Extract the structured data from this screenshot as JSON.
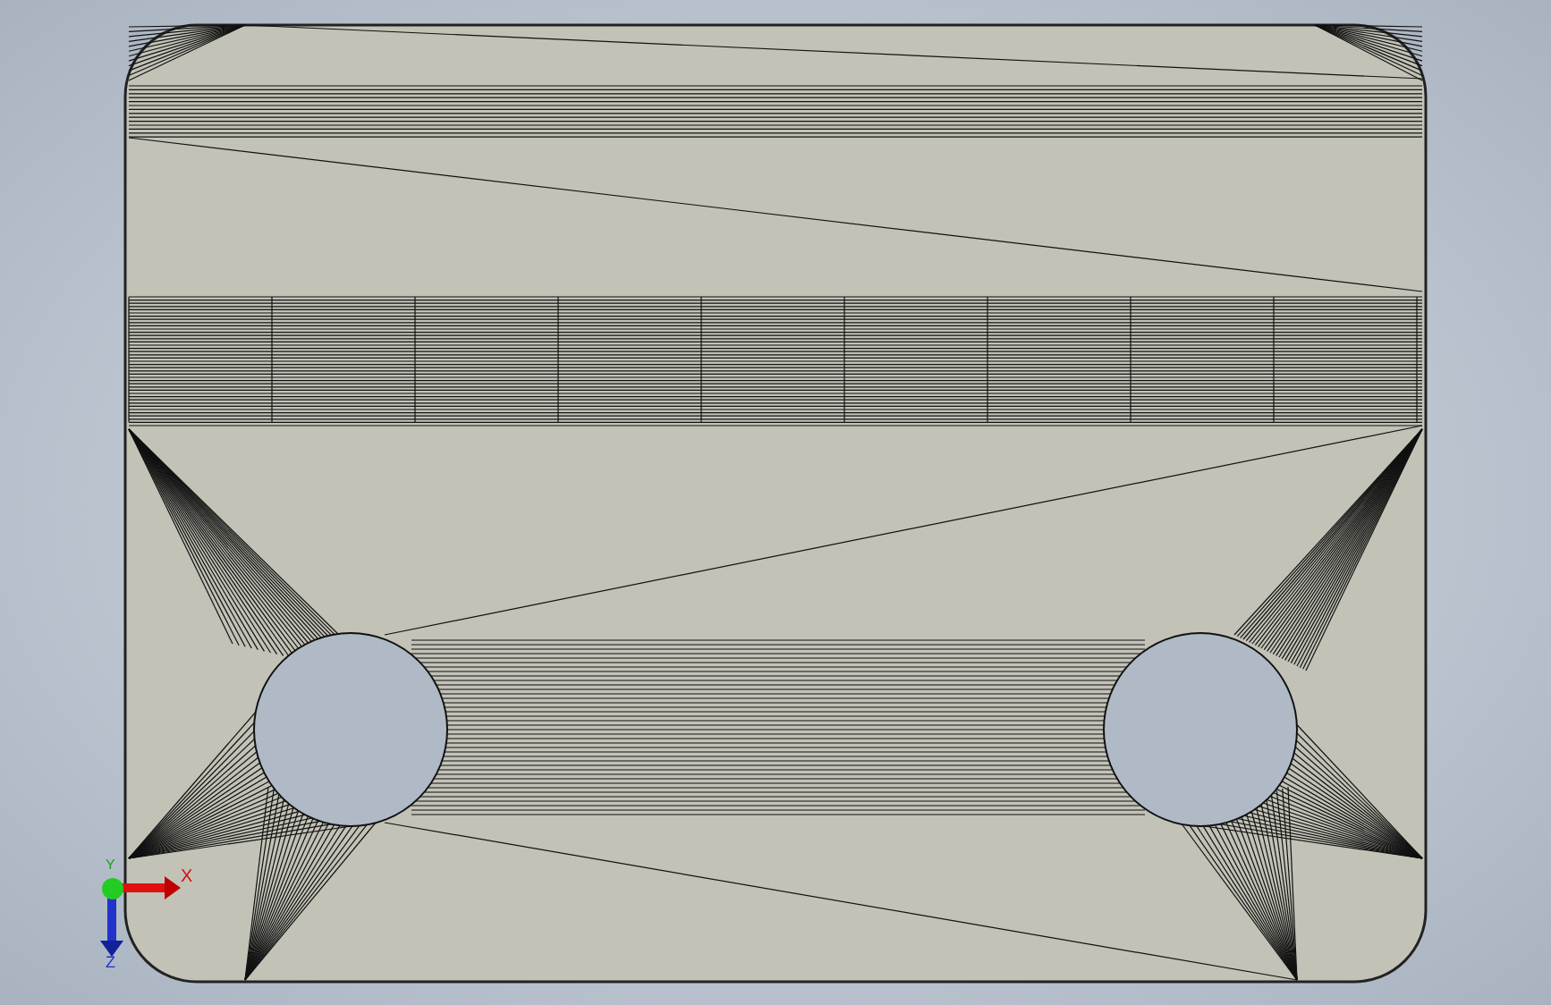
{
  "viewport": {
    "triad": {
      "x_label": "X",
      "y_label": "Y",
      "z_label": "Z"
    }
  }
}
